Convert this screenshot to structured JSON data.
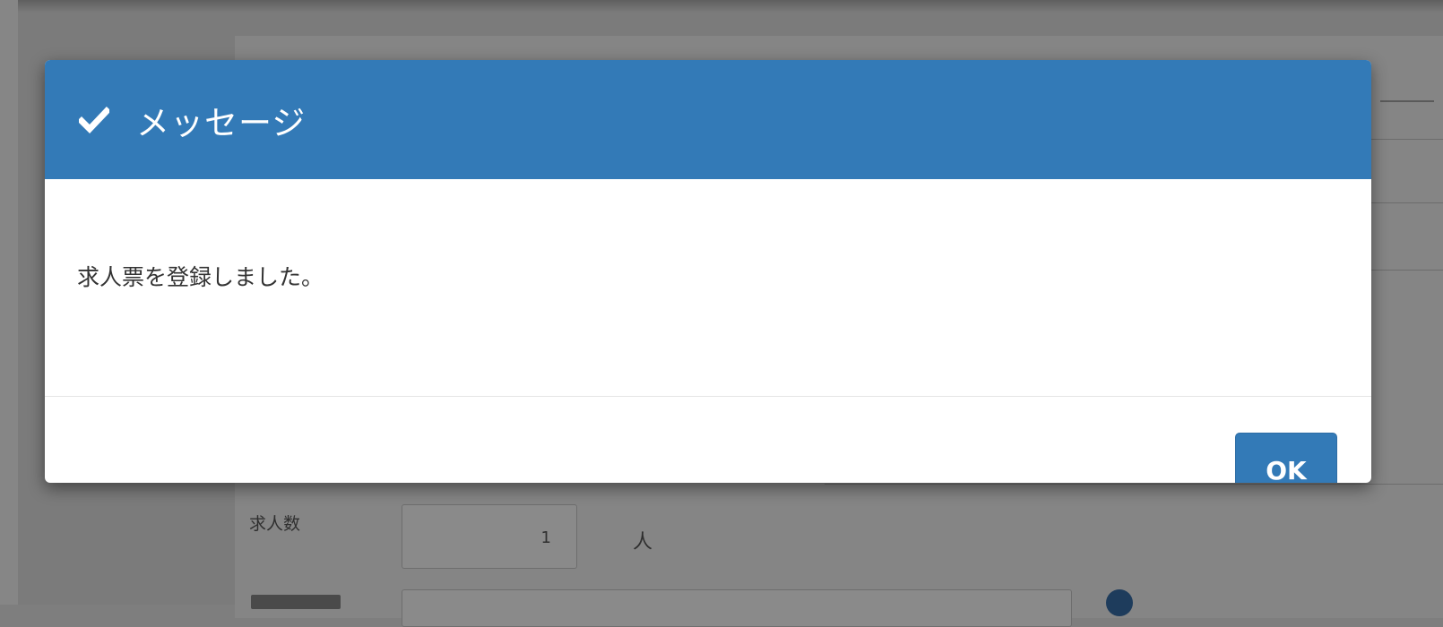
{
  "dialog": {
    "title": "メッセージ",
    "message": "求人票を登録しました。",
    "ok_label": "OK",
    "header_icon": "check-icon",
    "header_color": "#337ab7",
    "button_color": "#337ab7"
  },
  "background_form": {
    "recruit_count_label": "求人数",
    "recruit_count_value": "1",
    "recruit_count_unit": "人"
  }
}
